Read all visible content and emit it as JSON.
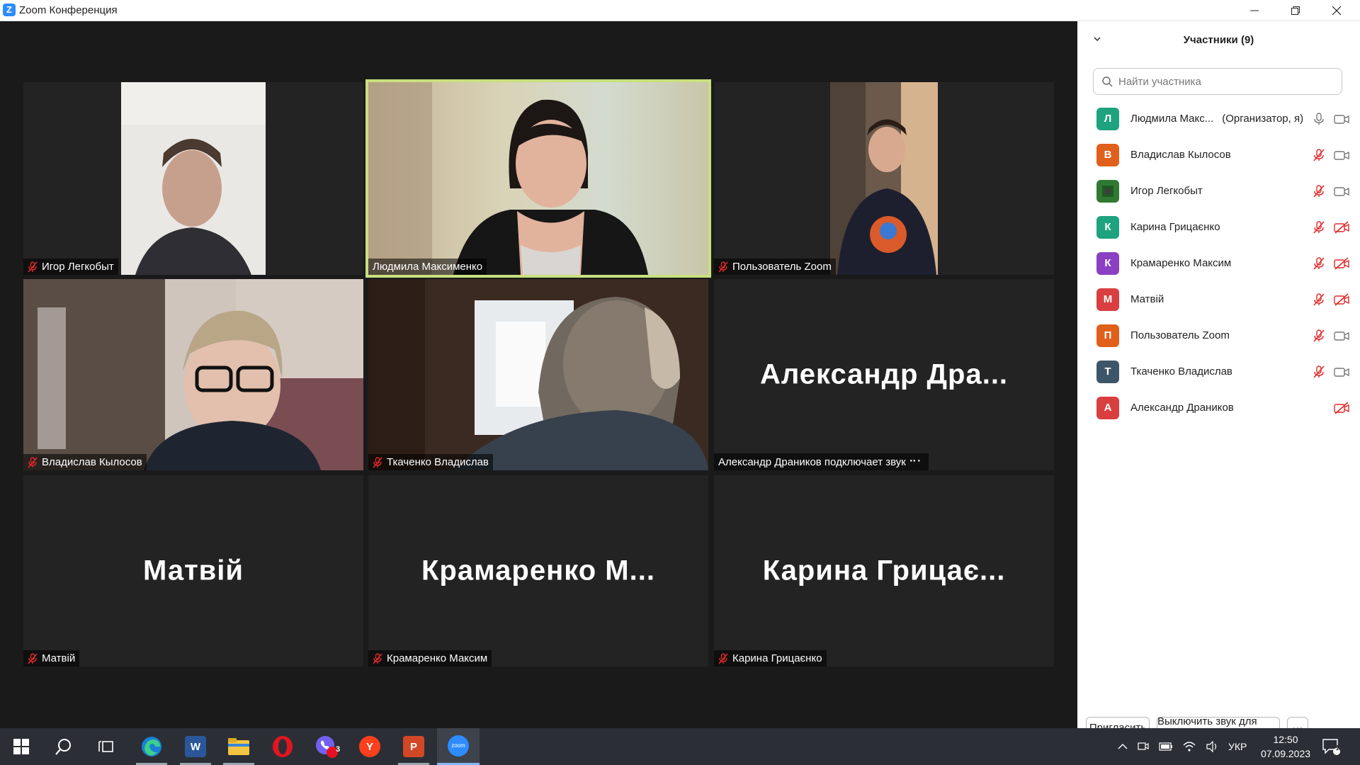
{
  "window": {
    "title": "Zoom Конференция"
  },
  "tiles": [
    {
      "name": "Игорь Легкобыт",
      "label": "Игор Легкобыт",
      "muted": true,
      "kind": "video",
      "active": false
    },
    {
      "name": "Людмила Максименко",
      "label": "Людмила Максименко",
      "muted": false,
      "kind": "video",
      "active": true
    },
    {
      "name": "Пользователь Zoom",
      "label": "Пользователь Zoom",
      "muted": true,
      "kind": "video",
      "active": false
    },
    {
      "name": "Владислав Кылосов",
      "label": "Владислав Кылосов",
      "muted": true,
      "kind": "video",
      "active": false
    },
    {
      "name": "Ткаченко Владислав",
      "label": "Ткаченко Владислав",
      "muted": true,
      "kind": "video",
      "active": false
    },
    {
      "name": "Александр Драников",
      "label": "Александр Драников подключает звук ⠒⠂",
      "big": "Александр  Дра...",
      "muted": false,
      "kind": "name",
      "active": false
    },
    {
      "name": "Матвій",
      "label": "Матвій",
      "big": "Матвій",
      "muted": true,
      "kind": "name",
      "active": false
    },
    {
      "name": "Крамаренко Максим",
      "label": "Крамаренко Максим",
      "big": "Крамаренко  М...",
      "muted": true,
      "kind": "name",
      "active": false
    },
    {
      "name": "Карина Грицаєнко",
      "label": "Карина Грицаєнко",
      "big": "Карина  Грицає...",
      "muted": true,
      "kind": "name",
      "active": false
    }
  ],
  "panel": {
    "title": "Участники (9)",
    "search_placeholder": "Найти участника",
    "participants": [
      {
        "initial": "Л",
        "name": "Людмила Макс...",
        "suffix": "(Организатор, я)",
        "color": "#1fa27e",
        "audio": "on",
        "video": "on"
      },
      {
        "initial": "В",
        "name": "Владислав Кылосов",
        "suffix": "",
        "color": "#e0601b",
        "audio": "muted",
        "video": "on"
      },
      {
        "initial": "",
        "name": "Игор Легкобыт",
        "suffix": "",
        "color": "#2f7a33",
        "audio": "muted",
        "video": "on"
      },
      {
        "initial": "К",
        "name": "Карина Грицаєнко",
        "suffix": "",
        "color": "#1fa27e",
        "audio": "muted",
        "video": "off"
      },
      {
        "initial": "К",
        "name": "Крамаренко Максим",
        "suffix": "",
        "color": "#8b3fc2",
        "audio": "muted",
        "video": "off"
      },
      {
        "initial": "М",
        "name": "Матвій",
        "suffix": "",
        "color": "#d93f3f",
        "audio": "muted",
        "video": "off"
      },
      {
        "initial": "П",
        "name": "Пользователь Zoom",
        "suffix": "",
        "color": "#e0601b",
        "audio": "muted",
        "video": "on"
      },
      {
        "initial": "Т",
        "name": "Ткаченко Владислав",
        "suffix": "",
        "color": "#3d5568",
        "audio": "muted",
        "video": "on"
      },
      {
        "initial": "А",
        "name": "Александр Драников",
        "suffix": "",
        "color": "#d93f3f",
        "audio": "none",
        "video": "off"
      }
    ],
    "invite_label": "Пригласить",
    "mute_all_label": "Выключить звук для всех",
    "more_label": "···"
  },
  "taskbar": {
    "apps": [
      "start",
      "search",
      "task-view",
      "edge",
      "word",
      "explorer",
      "opera",
      "viber",
      "yandex",
      "powerpoint",
      "zoom"
    ],
    "viber_badge": "3",
    "word_letter": "W",
    "ppt_letter": "P",
    "yandex_letter": "Y",
    "zoom_letter": "zoom",
    "lang": "УКР",
    "time": "12:50",
    "date": "07.09.2023",
    "notify_count": "1"
  }
}
